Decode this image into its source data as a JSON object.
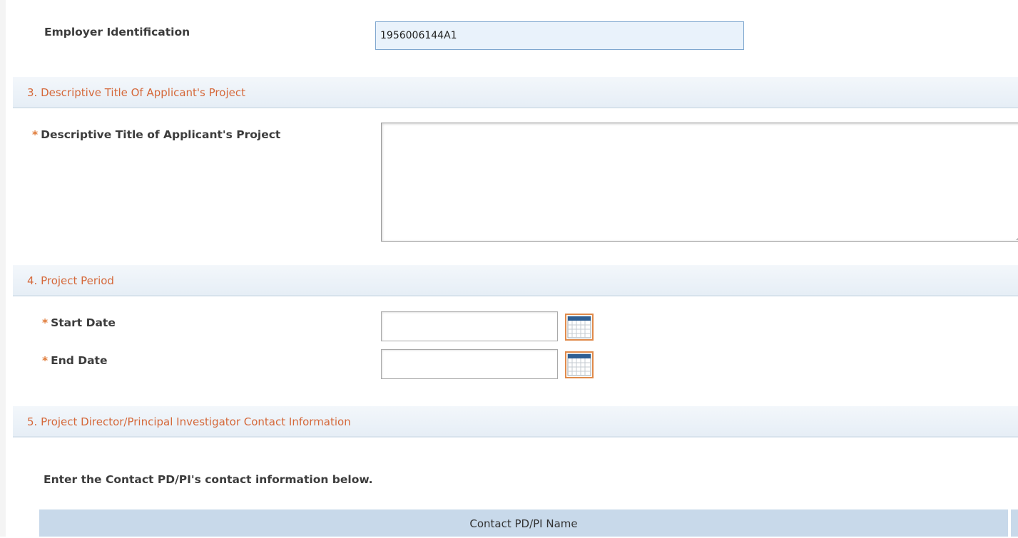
{
  "employer_identification": {
    "label": "Employer Identification",
    "value": "1956006144A1"
  },
  "section3": {
    "title": "3. Descriptive Title Of Applicant's Project",
    "field_label": "Descriptive Title of Applicant's Project",
    "value": ""
  },
  "section4": {
    "title": "4. Project Period",
    "start_date_label": "Start Date",
    "start_date_value": "",
    "end_date_label": "End Date",
    "end_date_value": ""
  },
  "section5": {
    "title": "5. Project Director/Principal Investigator Contact Information",
    "instruction": "Enter the Contact PD/PI's contact information below.",
    "table_columns": [
      "Contact PD/PI Name"
    ]
  },
  "required_marker": "*",
  "colors": {
    "section_title": "#d5683a",
    "required": "#e07b39",
    "ein_input_bg": "#e9f2fb",
    "table_header_bg": "#c8d9ea"
  }
}
